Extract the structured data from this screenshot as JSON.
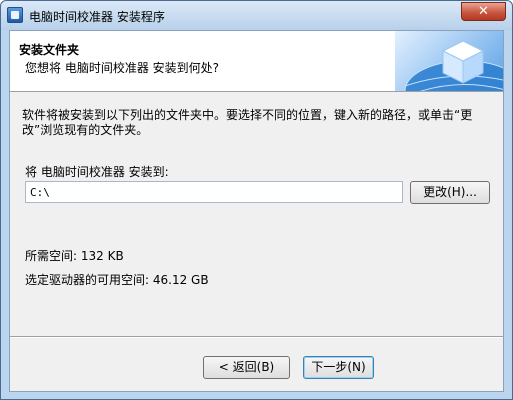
{
  "window": {
    "title": "电脑时间校准器 安装程序",
    "close_label": "✕"
  },
  "header": {
    "title": "安装文件夹",
    "subtitle": "您想将 电脑时间校准器 安装到何处?"
  },
  "content": {
    "description": "软件将被安装到以下列出的文件夹中。要选择不同的位置，键入新的路径，或单击“更改”浏览现有的文件夹。",
    "install_label": "将 电脑时间校准器 安装到:",
    "path_value": "C:\\",
    "browse_label": "更改(H)...",
    "required_space": "所需空间: 132 KB",
    "available_space": "选定驱动器的可用空间: 46.12 GB"
  },
  "footer": {
    "back_label": "< 返回(B)",
    "next_label": "下一步(N)"
  },
  "colors": {
    "title_bar": "#bcd5ee",
    "close_button": "#c7513b",
    "dialog_bg": "#f0f0f0",
    "header_bg": "#ffffff"
  }
}
